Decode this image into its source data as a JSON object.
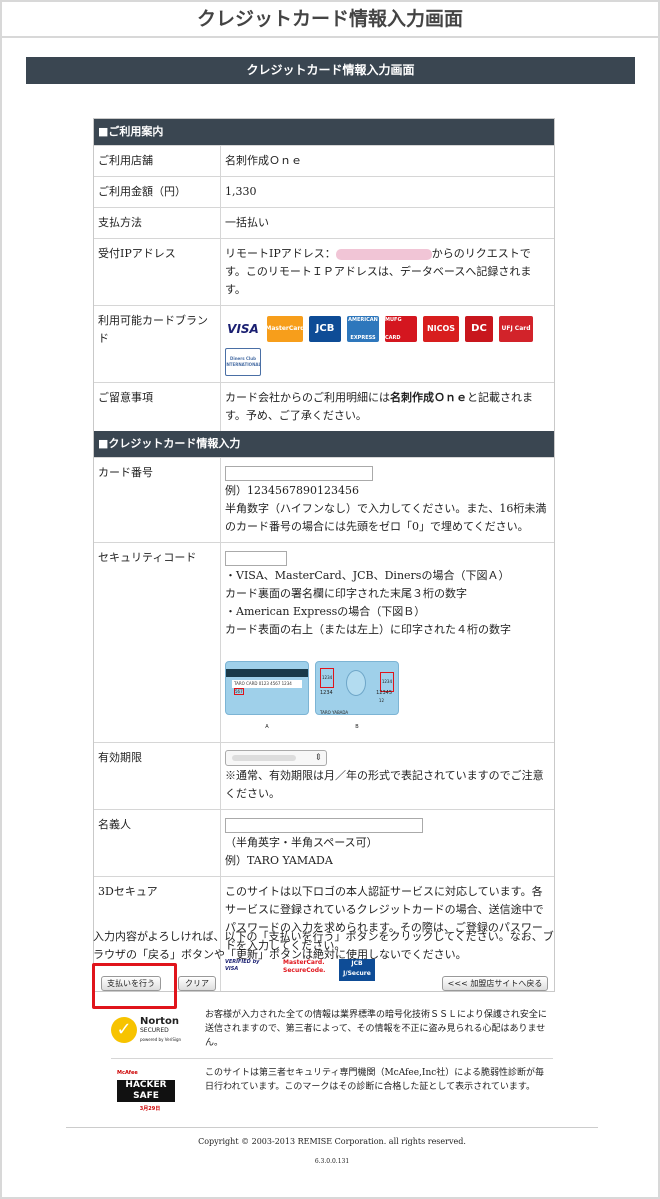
{
  "page_title": "クレジットカード情報入力画面",
  "header_band": "クレジットカード情報入力画面",
  "section_usage": {
    "title": "■ご利用案内",
    "rows": [
      {
        "label": "ご利用店舗",
        "value": "名刺作成Ｏｎｅ"
      },
      {
        "label": "ご利用金額（円）",
        "value": "1,330"
      },
      {
        "label": "支払方法",
        "value": "一括払い"
      }
    ],
    "ip_label": "受付IPアドレス",
    "ip_prefix": "リモートIPアドレス：",
    "ip_suffix": "からのリクエストです。このリモートＩＰアドレスは、データベースへ記録されます。",
    "brands_label": "利用可能カードブランド",
    "brands": [
      "VISA",
      "MasterCard",
      "JCB",
      "AMERICAN EXPRESS",
      "MUFG CARD",
      "NICOS",
      "DC",
      "UFJ Card",
      "Diners Club INTERNATIONAL"
    ],
    "notes_label": "ご留意事項",
    "notes_pre": "カード会社からのご利用明細には",
    "notes_bold": "名刺作成Ｏｎｅ",
    "notes_post": "と記載されます。予め、ご了承ください。"
  },
  "section_card": {
    "title": "■クレジットカード情報入力",
    "number_label": "カード番号",
    "number_example": "例）1234567890123456",
    "number_help": "半角数字（ハイフンなし）で入力してください。また、16桁未満のカード番号の場合には先頭をゼロ「0」で埋めてください。",
    "security_label": "セキュリティコード",
    "security_lines": [
      "・VISA、MasterCard、JCB、Dinersの場合（下図Ａ）",
      "カード裏面の署名欄に印字された末尾３桁の数字",
      "・American Expressの場合（下図Ｂ）",
      "カード表面の右上（または左上）に印字された４桁の数字"
    ],
    "card_a": {
      "caption": "A",
      "sign": "TARO CARD 0123 4567",
      "code": "567",
      "prefix": "1234"
    },
    "card_b": {
      "caption": "B",
      "name": "TARO YABADA",
      "code4": "1234",
      "num1": "1234",
      "num2": "12345",
      "num3": "12"
    },
    "expiry_label": "有効期限",
    "expiry_help": "※通常、有効期限は月／年の形式で表記されていますのでご注意ください。",
    "name_label": "名義人",
    "name_help1": "（半角英字・半角スペース可）",
    "name_help2": "例）TARO YAMADA",
    "secure_label": "3Dセキュア",
    "secure_text": "このサイトは以下ロゴの本人認証サービスに対応しています。各サービスに登録されているクレジットカードの場合、送信途中でパスワードの入力を求められます。その際は、ご登録のパスワードを入力してください。",
    "secure_logos": [
      "VERIFIED by VISA",
      "MasterCard. SecureCode.",
      "JCB J/Secure"
    ]
  },
  "notice": "入力内容がよろしければ、以下の「支払いを行う」ボタンをクリックしてください。なお、ブラウザの「戻る」ボタンや「更新」ボタンは絶対に使用しないでください。",
  "buttons": {
    "pay": "支払いを行う",
    "clear": "クリア",
    "back": "<<< 加盟店サイトへ戻る"
  },
  "norton": {
    "text": "お客様が入力された全ての情報は業界標準の暗号化技術ＳＳＬにより保護され安全に送信されますので、第三者によって、その情報を不正に盗み見られる心配はありません。",
    "logo_main": "Norton",
    "logo_sub": "SECURED",
    "logo_by": "powered by VeriSign"
  },
  "mcafee": {
    "text": "このサイトは第三者セキュリティ専門機関（McAfee,Inc社）による脆弱性診断が毎日行われています。このマークはその診断に合格した証として表示されています。",
    "logo_top": "McAfee",
    "logo_main": "HACKER SAFE",
    "logo_date": "3月29日"
  },
  "copyright": "Copyright © 2003-2013 REMISE Corporation. all rights reserved.",
  "version": "6.3.0.0.131"
}
